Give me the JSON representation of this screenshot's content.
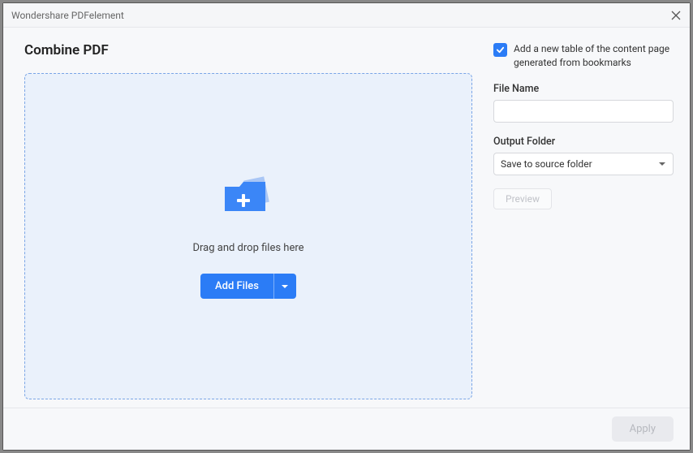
{
  "titlebar": {
    "title": "Wondershare PDFelement"
  },
  "main": {
    "heading": "Combine PDF",
    "dropzone": {
      "hint": "Drag and drop files here",
      "add_files_label": "Add Files"
    }
  },
  "side": {
    "toc_checkbox_label": "Add a new table of the content page generated from bookmarks",
    "toc_checked": true,
    "file_name": {
      "label": "File Name",
      "value": ""
    },
    "output_folder": {
      "label": "Output Folder",
      "selected": "Save to source folder"
    },
    "preview_label": "Preview"
  },
  "footer": {
    "apply_label": "Apply"
  }
}
